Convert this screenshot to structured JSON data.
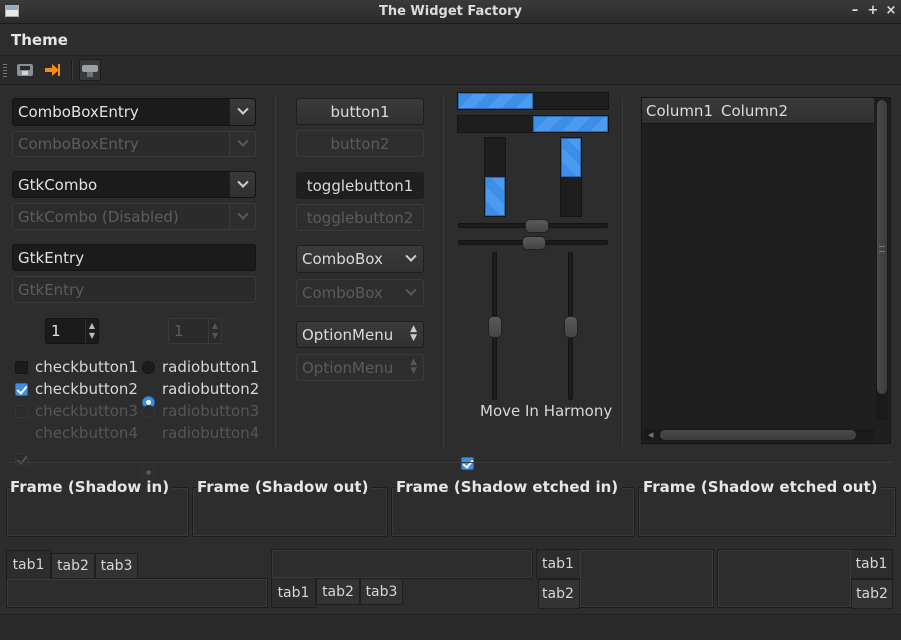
{
  "window": {
    "title": "The Widget Factory"
  },
  "menubar": {
    "theme": "Theme"
  },
  "col1": {
    "combo_entry": "ComboBoxEntry",
    "combo_entry_dis": "ComboBoxEntry",
    "gtk_combo": "GtkCombo",
    "gtk_combo_dis": "GtkCombo (Disabled)",
    "entry": "GtkEntry",
    "entry_dis": "GtkEntry",
    "spin1": "1",
    "spin2": "1",
    "checks": [
      "checkbutton1",
      "checkbutton2",
      "checkbutton3",
      "checkbutton4"
    ],
    "radios": [
      "radiobutton1",
      "radiobutton2",
      "radiobutton3",
      "radiobutton4"
    ]
  },
  "col2": {
    "button1": "button1",
    "button2": "button2",
    "toggle1": "togglebutton1",
    "toggle2": "togglebutton2",
    "combobox": "ComboBox",
    "combobox_dis": "ComboBox",
    "optionmenu": "OptionMenu",
    "optionmenu_dis": "OptionMenu"
  },
  "col3": {
    "harmony": "Move In Harmony",
    "progress": {
      "h1": 0.5,
      "h2": 0.5,
      "v1": 0.5,
      "v2": 0.5
    },
    "scales": {
      "h1": 0.52,
      "h2": 0.5,
      "v1": 0.5,
      "v2": 0.5
    }
  },
  "tree": {
    "columns": [
      "Column1",
      "Column2"
    ]
  },
  "frames": [
    "Frame (Shadow in)",
    "Frame (Shadow out)",
    "Frame (Shadow etched in)",
    "Frame (Shadow etched out)"
  ],
  "notebooks": {
    "tabs": [
      "tab1",
      "tab2",
      "tab3"
    ]
  },
  "colors": {
    "accent": "#3d8ee6",
    "bg": "#2d2d2d"
  }
}
